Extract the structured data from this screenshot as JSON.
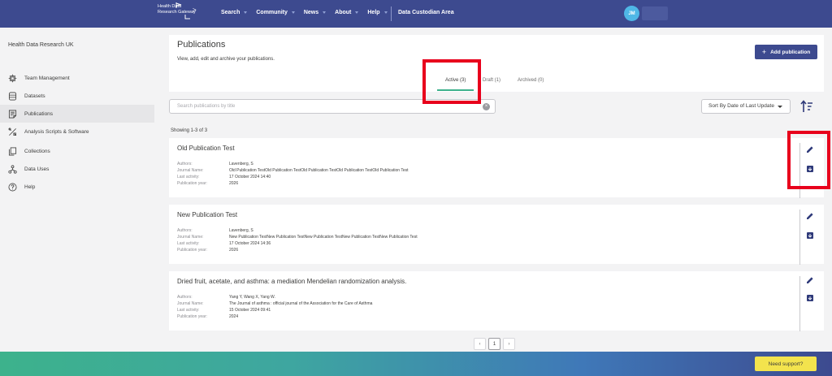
{
  "header": {
    "logo_line1": "Health Data",
    "logo_line2": "Research Gateway",
    "logo_chevron": ">",
    "nav": [
      "Search",
      "Community",
      "News",
      "About",
      "Help"
    ],
    "custodian_link": "Data Custodian Area",
    "avatar_initials": "JM"
  },
  "sidebar": {
    "org_name": "Health Data Research UK",
    "items": [
      {
        "label": "Team Management",
        "icon": "gear-icon"
      },
      {
        "label": "Datasets",
        "icon": "database-icon"
      },
      {
        "label": "Publications",
        "icon": "document-icon"
      },
      {
        "label": "Analysis Scripts & Software",
        "icon": "tools-icon"
      },
      {
        "label": "Collections",
        "icon": "collection-icon"
      },
      {
        "label": "Data Uses",
        "icon": "data-uses-icon"
      },
      {
        "label": "Help",
        "icon": "help-icon"
      }
    ]
  },
  "page": {
    "title": "Publications",
    "subtitle": "View, add, edit and archive your publications.",
    "add_button": "Add publication",
    "tabs": [
      {
        "label": "Active (3)",
        "active": true
      },
      {
        "label": "Draft (1)"
      },
      {
        "label": "Archived (0)"
      }
    ],
    "search_placeholder": "Search publications by title",
    "sort_label": "Sort By Date of Last Update",
    "showing": "Showing 1-3 of 3"
  },
  "meta_labels": {
    "authors": "Authors:",
    "journal": "Journal Name:",
    "activity": "Last activity:",
    "year": "Publication year:"
  },
  "publications": [
    {
      "title": "Old Publication Test",
      "authors": "Lavenberg, S",
      "journal": "Old Publication TestOld Publication TestOld Publication TestOld Publication TestOld Publication Test",
      "last_activity": "17 October 2024 14:40",
      "year": "2026"
    },
    {
      "title": "New Publication Test",
      "authors": "Lavenberg, S",
      "journal": "New Publication TestNew Publication TestNew Publication TestNew Publication TestNew Publication Test",
      "last_activity": "17 October 2024 14:36",
      "year": "2026"
    },
    {
      "title": "Dried fruit, acetate, and asthma: a mediation Mendelian randomization analysis.",
      "authors": "Yang Y, Wang X, Yang W.",
      "journal": "The Journal of asthma : official journal of the Association for the Care of Asthma",
      "last_activity": "15 October 2024 09:41",
      "year": "2024"
    }
  ],
  "pagination": {
    "prev": "‹",
    "current": "1",
    "next": "›"
  },
  "support_button": "Need support?",
  "colors": {
    "brand": "#3d4a8f",
    "accent": "#3db28c",
    "highlight": "#e8001c",
    "support": "#f3e34d"
  }
}
